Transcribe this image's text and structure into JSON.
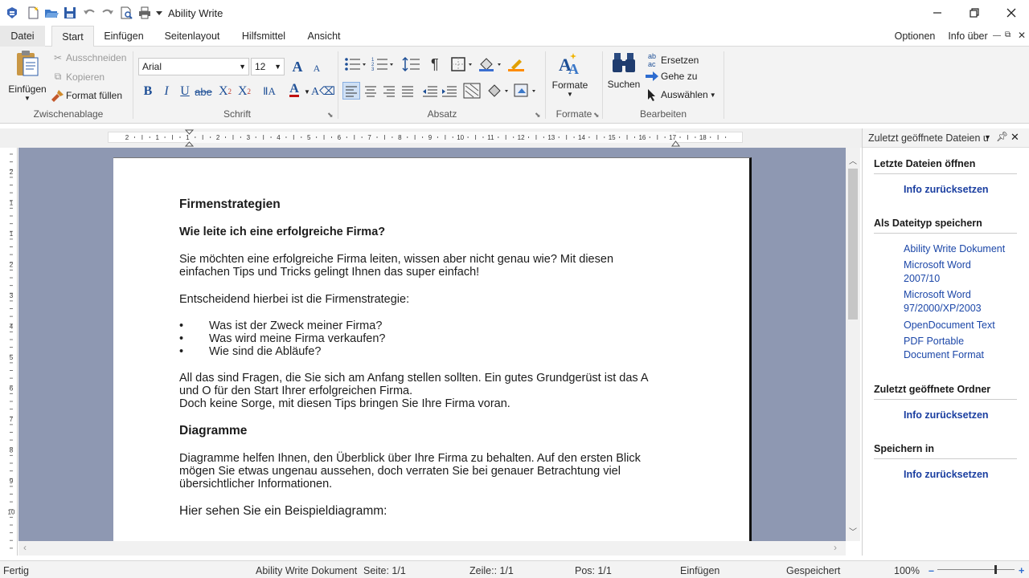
{
  "app": {
    "title": "Ability Write"
  },
  "menu": {
    "tabs": [
      "Datei",
      "Start",
      "Einfügen",
      "Seitenlayout",
      "Hilfsmittel",
      "Ansicht"
    ],
    "right": [
      "Optionen",
      "Info über"
    ]
  },
  "ribbon": {
    "clipboard": {
      "paste": "Einfügen",
      "cut": "Ausschneiden",
      "copy": "Kopieren",
      "format_fill": "Format füllen",
      "group": "Zwischenablage"
    },
    "font": {
      "name": "Arial",
      "size": "12",
      "group": "Schrift"
    },
    "paragraph": {
      "group": "Absatz"
    },
    "formats": {
      "button": "Formate",
      "group": "Formate"
    },
    "edit": {
      "search": "Suchen",
      "replace": "Ersetzen",
      "goto": "Gehe zu",
      "select": "Auswählen",
      "group": "Bearbeiten"
    }
  },
  "ruler": {
    "h_numbers": [
      "2",
      "1",
      "1",
      "2",
      "3",
      "4",
      "5",
      "6",
      "7",
      "8",
      "9",
      "10",
      "11",
      "12",
      "13",
      "14",
      "15",
      "16",
      "17",
      "18"
    ],
    "v_numbers": [
      "2",
      "1",
      "1",
      "2",
      "3",
      "4",
      "5",
      "6",
      "7",
      "8",
      "9",
      "10"
    ]
  },
  "document": {
    "title": "Firmenstrategien",
    "subtitle": "Wie leite ich eine erfolgreiche Firma?",
    "p1_line1": "Sie möchten eine erfolgreiche Firma leiten, wissen aber nicht genau wie? Mit diesen",
    "p1_line2": "einfachen Tips und Tricks gelingt Ihnen das super einfach!",
    "p2": "Entscheidend hierbei ist die Firmenstrategie:",
    "bullets": [
      "Was ist der Zweck meiner Firma?",
      "Was wird meine Firma verkaufen?",
      "Wie sind die Abläufe?"
    ],
    "p3_line1": "All das sind Fragen, die Sie sich am Anfang stellen sollten. Ein gutes Grundgerüst ist das A",
    "p3_line2": "und O für den Start Ihrer erfolgreichen Firma.",
    "p3_line3": "Doch keine Sorge, mit diesen Tips bringen Sie Ihre Firma voran.",
    "h2": "Diagramme",
    "p4_line1": "Diagramme helfen Ihnen, den Überblick über Ihre Firma zu behalten. Auf den ersten Blick",
    "p4_line2": "mögen Sie etwas ungenau aussehen, doch verraten Sie bei genauer Betrachtung viel",
    "p4_line3": "übersichtlicher Informationen.",
    "p5": "Hier sehen Sie ein Beispieldiagramm:"
  },
  "pane": {
    "title": "Zuletzt geöffnete Dateien u",
    "recent_header": "Letzte Dateien öffnen",
    "reset1": "Info zurücksetzen",
    "save_as_header": "Als Dateityp speichern",
    "types": [
      [
        "Ability Write Dokument"
      ],
      [
        "Microsoft Word",
        "2007/10"
      ],
      [
        "Microsoft Word",
        "97/2000/XP/2003"
      ],
      [
        "OpenDocument Text"
      ],
      [
        "PDF Portable",
        "Document Format"
      ]
    ],
    "folders_header": "Zuletzt geöffnete Ordner",
    "reset2": "Info zurücksetzen",
    "save_in_header": "Speichern in",
    "reset3": "Info zurücksetzen"
  },
  "status": {
    "ready": "Fertig",
    "doc_type": "Ability Write Dokument",
    "page": "Seite: 1/1",
    "line": "Zeile:: 1/1",
    "pos": "Pos: 1/1",
    "mode": "Einfügen",
    "saved": "Gespeichert",
    "zoom": "100%",
    "zoom_level": 0.75
  },
  "colors": {
    "accent": "#1c47a8",
    "workspace": "#8e98b2"
  }
}
